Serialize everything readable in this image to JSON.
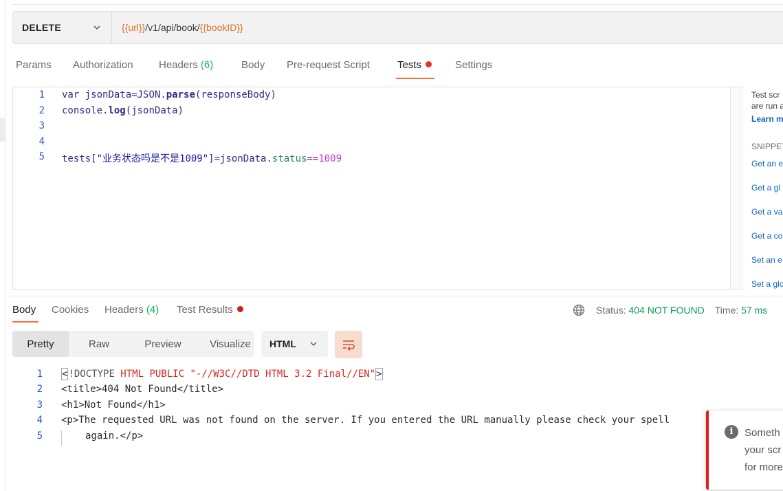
{
  "request": {
    "method": "DELETE",
    "url_parts": [
      {
        "text": "{{url}}",
        "type": "variable"
      },
      {
        "text": "/v1/api/book/",
        "type": "plain"
      },
      {
        "text": "{{bookID}}",
        "type": "variable"
      }
    ]
  },
  "request_tabs": [
    {
      "label": "Params"
    },
    {
      "label": "Authorization"
    },
    {
      "label": "Headers",
      "count": "(6)"
    },
    {
      "label": "Body"
    },
    {
      "label": "Pre-request Script"
    },
    {
      "label": "Tests",
      "active": true,
      "indicator": "dot"
    },
    {
      "label": "Settings"
    }
  ],
  "editor": {
    "line_numbers": [
      "1",
      "2",
      "3",
      "4",
      "5"
    ],
    "line1": {
      "kw": "var",
      "ident": " jsonData",
      "op": "=",
      "obj": "JSON",
      "dot": ".",
      "fn": "parse",
      "rest": "(responseBody)"
    },
    "line2": {
      "obj": "console",
      "dot": ".",
      "fn": "log",
      "rest": "(jsonData)"
    },
    "line5": {
      "ident": "tests",
      "open": "[",
      "str": "\"业务状态吗是不是1009\"",
      "close": "]",
      "op": "=",
      "obj": "jsonData",
      "dot": ".",
      "prop": "status",
      "eq": "==",
      "num": "1009"
    }
  },
  "help_panel": {
    "intro_line1": "Test scr",
    "intro_line2": "are run a",
    "learn_more": "Learn m",
    "snippets_heading": "SNIPPET",
    "snippets": [
      "Get an e",
      "Get a gl",
      "Get a va",
      "Get a co",
      "Set an e",
      "Set a glo"
    ]
  },
  "response_tabs": [
    {
      "label": "Body",
      "active": true
    },
    {
      "label": "Cookies"
    },
    {
      "label": "Headers",
      "count": "(4)"
    },
    {
      "label": "Test Results",
      "indicator": "dot"
    }
  ],
  "response_meta": {
    "status_label": "Status:",
    "status_value": "404 NOT FOUND",
    "time_label": "Time:",
    "time_value": "57 ms"
  },
  "view_modes": [
    "Pretty",
    "Raw",
    "Preview",
    "Visualize"
  ],
  "active_view_mode": "Pretty",
  "response_language": "HTML",
  "response_body": {
    "line_numbers": [
      "1",
      "2",
      "3",
      "4",
      "5"
    ],
    "line1": {
      "open": "<",
      "doctype": "!DOCTYPE",
      "rest": " HTML PUBLIC \"-//W3C//DTD HTML 3.2 Final//EN\"",
      "close": ">"
    },
    "line2": "<title>404 Not Found</title>",
    "line3": "<h1>Not Found</h1>",
    "line4": "<p>The requested URL was not found on the server. If you entered the URL manually please check your spell",
    "line5": "again.</p>"
  },
  "toast": {
    "line1": "Someth",
    "line2": "your scr",
    "line3": "for more"
  },
  "colors": {
    "accent_orange": "#ff6c37",
    "variable_orange": "#e8702a",
    "count_green": "#0cbb52",
    "status_green": "#0a9f52",
    "error_red": "#dc2020"
  }
}
